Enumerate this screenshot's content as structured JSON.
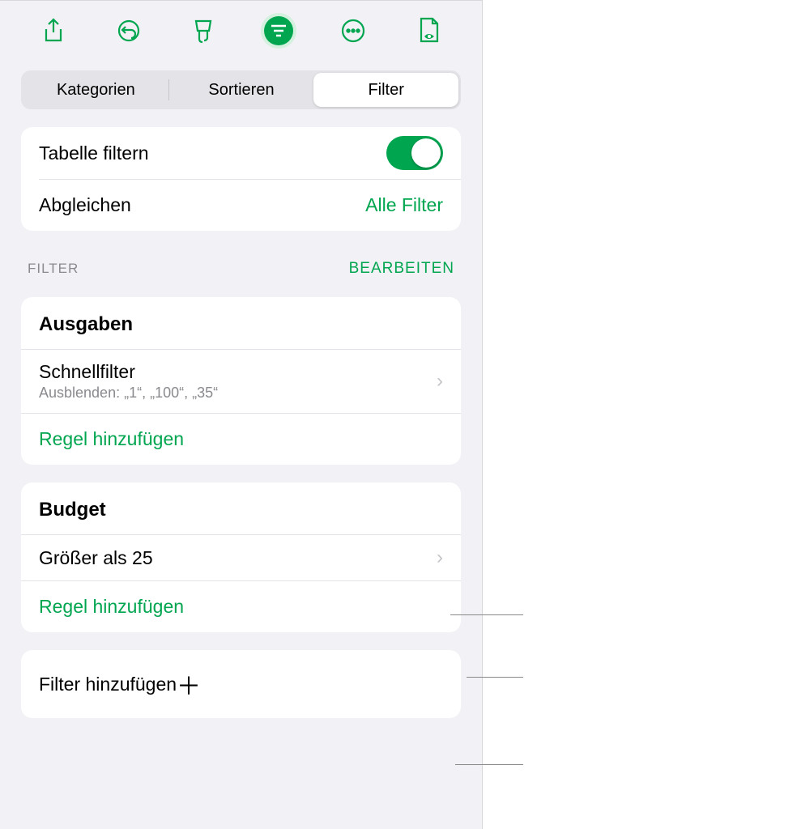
{
  "tabs": {
    "categories": "Kategorien",
    "sort": "Sortieren",
    "filter": "Filter"
  },
  "filterTable": {
    "label": "Tabelle filtern",
    "on": true
  },
  "match": {
    "label": "Abgleichen",
    "value": "Alle Filter"
  },
  "section": {
    "header": "FILTER",
    "edit": "BEARBEITEN"
  },
  "groups": [
    {
      "name": "Ausgaben",
      "rules": [
        {
          "title": "Schnellfilter",
          "sub": "Ausblenden: „1“, „100“, „35“"
        }
      ],
      "add": "Regel hinzufügen"
    },
    {
      "name": "Budget",
      "rules": [
        {
          "title": "Größer als 25",
          "sub": ""
        }
      ],
      "add": "Regel hinzufügen"
    }
  ],
  "addFilter": "Filter hinzufügen"
}
